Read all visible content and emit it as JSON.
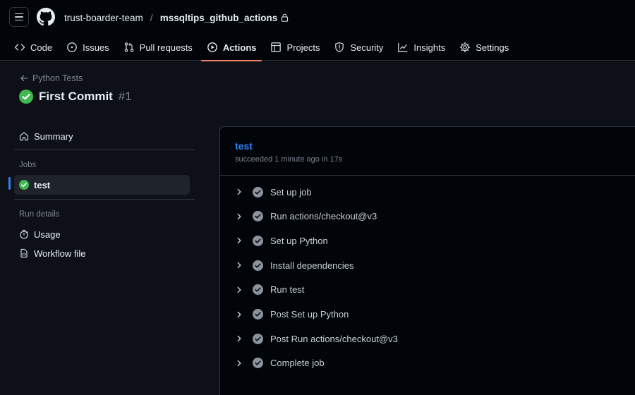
{
  "header": {
    "owner": "trust-boarder-team",
    "separator": "/",
    "repo": "mssqltips_github_actions"
  },
  "nav": {
    "tabs": [
      {
        "label": "Code",
        "icon": "code-icon"
      },
      {
        "label": "Issues",
        "icon": "issue-icon"
      },
      {
        "label": "Pull requests",
        "icon": "pull-request-icon"
      },
      {
        "label": "Actions",
        "icon": "play-icon",
        "active": true
      },
      {
        "label": "Projects",
        "icon": "table-icon"
      },
      {
        "label": "Security",
        "icon": "shield-icon"
      },
      {
        "label": "Insights",
        "icon": "graph-icon"
      },
      {
        "label": "Settings",
        "icon": "gear-icon"
      }
    ]
  },
  "run": {
    "back_label": "Python Tests",
    "title": "First Commit",
    "number": "#1"
  },
  "sidebar": {
    "summary_label": "Summary",
    "jobs_heading": "Jobs",
    "job_label": "test",
    "run_details_heading": "Run details",
    "usage_label": "Usage",
    "workflow_file_label": "Workflow file"
  },
  "job": {
    "name": "test",
    "status": "succeeded 1 minute ago in 17s",
    "steps": [
      "Set up job",
      "Run actions/checkout@v3",
      "Set up Python",
      "Install dependencies",
      "Run test",
      "Post Set up Python",
      "Post Run actions/checkout@v3",
      "Complete job"
    ]
  },
  "colors": {
    "accent_link": "#2f81f7",
    "success": "#3fb950",
    "active_tab_underline": "#f78166",
    "step_check": "#8b949e"
  }
}
